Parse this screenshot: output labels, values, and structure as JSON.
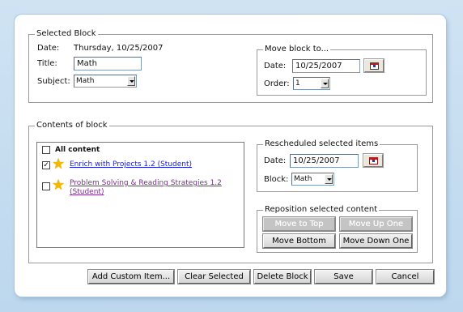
{
  "selected_block": {
    "legend": "Selected Block",
    "date_label": "Date:",
    "date_value": "Thursday, 10/25/2007",
    "title_label": "Title:",
    "title_value": "Math",
    "subject_label": "Subject:",
    "subject_value": "Math"
  },
  "move_block": {
    "legend": "Move block to...",
    "date_label": "Date:",
    "date_value": "10/25/2007",
    "order_label": "Order:",
    "order_value": "1"
  },
  "contents": {
    "legend": "Contents of block",
    "all_content_label": "All content",
    "items": [
      {
        "label": "Enrich with Projects 1.2 (Student)",
        "checked": true,
        "icon": "star-icon"
      },
      {
        "label_line1": "Problem Solving & Reading Strategies 1.2",
        "label_line2": "(Student)",
        "checked": false,
        "icon": "star-icon"
      }
    ]
  },
  "rescheduled": {
    "legend": "Rescheduled selected items",
    "date_label": "Date:",
    "date_value": "10/25/2007",
    "block_label": "Block:",
    "block_value": "Math"
  },
  "reposition": {
    "legend": "Reposition selected content",
    "move_to_top": "Move to Top",
    "move_up_one": "Move Up One",
    "move_bottom": "Move Bottom",
    "move_down_one": "Move Down One"
  },
  "footer": {
    "add_custom": "Add Custom Item...",
    "clear_selected": "Clear Selected",
    "delete_block": "Delete Block",
    "save": "Save",
    "cancel": "Cancel"
  },
  "colors": {
    "link_visited": "#7d2c8f",
    "link": "#1b22c8",
    "star": "#f2b800",
    "background": "#bdd7ee"
  }
}
